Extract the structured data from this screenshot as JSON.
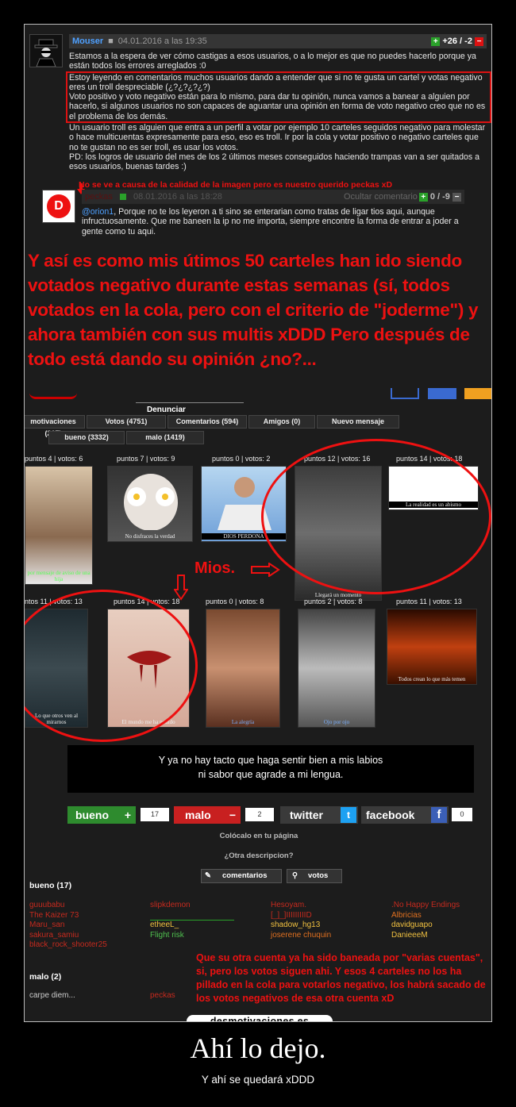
{
  "comment1": {
    "user": "Mouser",
    "date": "04.01.2016 a las 19:35",
    "votes": "+26 / -2",
    "intro": "Estamos a la espera de ver cómo castigas a esos usuarios, o a lo mejor es que no puedes hacerlo porque ya están todos los errores arreglados :0",
    "boxed1": "Estoy leyendo en comentarios muchos usuarios dando a entender que si no te gusta un cartel y votas negativo eres un troll despreciable (¿?¿?¿?¿?)",
    "boxed2": "Voto positivo y voto negativo están para lo mismo, para dar tu opinión, nunca vamos a banear a alguien por hacerlo, si algunos usuarios no son capaces de aguantar una opinión en forma de voto negativo creo que no es el problema de los demás.",
    "outro1": "Un usuario troll es alguien que entra a un perfil a votar por ejemplo 10 carteles seguidos negativo para molestar o hace multicuentas expresamente para eso, eso es troll. Ir por la cola y votar positivo o negativo carteles que no te gustan no es ser troll, es usar los votos.",
    "outro2": "PD: los logros de usuario del mes de los 2 últimos meses conseguidos haciendo trampas van a ser quitados a esos usuarios, buenas tardes :)"
  },
  "annot_small": "No se ve a causa de la calidad de la imagen pero es nuestro querido peckas xD",
  "comment2": {
    "user": "peckas",
    "date": "08.01.2016 a las 18:28",
    "hide_label": "Ocultar comentario",
    "votes": "0 / -9",
    "mention": "@orion1",
    "body": ", Porque no te los leyeron a ti sino se enterarian como tratas de ligar tios aqui, aunque infructuosamente. Que me baneen la ip no me importa, siempre encontre la forma de entrar a joder a gente como tu aqui."
  },
  "big_annot": "Y así es como mis útimos 50 carteles han ido siendo votados negativo durante estas semanas (sí, todos votados en la cola, pero con el criterio de \"joderme\") y ahora también con sus multis xDDD Pero después de todo está dando su opinión ¿no?...",
  "profile": {
    "denunciar": "Denunciar",
    "tabs": [
      "motivaciones (217)",
      "Votos (4751)",
      "Comentarios (594)",
      "Amigos (0)",
      "Nuevo mensaje"
    ],
    "subtabs": [
      "bueno (3332)",
      "malo (1419)"
    ]
  },
  "thumbs_row1": [
    {
      "caption": "puntos 4 | votos: 6",
      "title": "por mensaje de aviso de una hija"
    },
    {
      "caption": "puntos 7 | votos: 9",
      "title": "No disfraces la verdad"
    },
    {
      "caption": "puntos 0 | votos: 2",
      "title": "DIOS PERDONA"
    },
    {
      "caption": "puntos 12 | votos: 16",
      "title": "Llegará un momento"
    },
    {
      "caption": "puntos 14 | votos: 18",
      "title": "La realidad es un abismo"
    }
  ],
  "thumbs_row2": [
    {
      "caption": "ntos 11 | votos: 13",
      "title": "Lo que otros ven al mirarnos"
    },
    {
      "caption": "puntos 14 | votos: 18",
      "title": "El mundo me ha podido"
    },
    {
      "caption": "puntos 0 | votos: 8",
      "title": "La alegría"
    },
    {
      "caption": "puntos 2 | votos: 8",
      "title": "Ojo por ojo"
    },
    {
      "caption": "puntos 11 | votos: 13",
      "title": "Todos crean lo que más temen"
    }
  ],
  "mios": "Mios.",
  "poster": {
    "line1": "Y ya no hay tacto que haga sentir bien a mis labios",
    "line2": "ni sabor que agrade a mi lengua."
  },
  "votes_bar": {
    "bueno_label": "bueno",
    "bueno_count": "17",
    "malo_label": "malo",
    "malo_count": "2",
    "twitter_label": "twitter",
    "facebook_label": "facebook",
    "facebook_count": "0"
  },
  "colocalo": "Colócalo en tu página",
  "otra_desc": "¿Otra descripcion?",
  "comentarios_btn": "comentarios",
  "votos_btn": "votos",
  "bueno_heading": "bueno (17)",
  "bueno_col1": [
    "guuubabu",
    "The Kaizer 73",
    "Maru_san",
    "sakura_samiu",
    "black_rock_shooter25"
  ],
  "bueno_col2": [
    "slipkdemon",
    "etheeL_",
    "Flight risk"
  ],
  "bueno_col3": [
    "Hesoyam.",
    "[_]_]IIIIIIIIID",
    "shadow_hg13",
    "joserene chuquin"
  ],
  "bueno_col4": [
    ".No Happy Endings",
    "Albricias",
    "davidguapo",
    "DanieeeM"
  ],
  "malo_heading": "malo (2)",
  "malo_col1": "carpe diem...",
  "malo_col2": "peckas",
  "annot_bottom": "Que su otra cuenta ya ha sido baneada por \"varias cuentas\", si, pero los votos siguen ahi. Y esos 4 carteles no los ha pillado en la cola para votarlos negativo, los habrá sacado de los votos negativos de esa otra cuenta xD",
  "brand": "desmotivaciones.es",
  "title": "Ahí lo dejo.",
  "subtitle": "Y ahí se quedará xDDD"
}
